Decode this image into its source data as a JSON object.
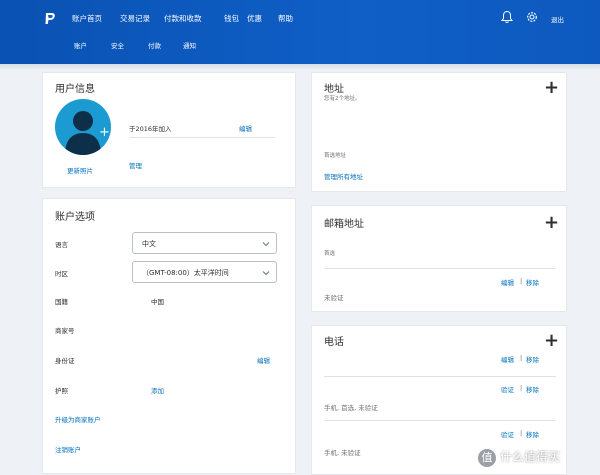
{
  "nav": {
    "items": [
      "账户首页",
      "交易记录",
      "付款和收款",
      "钱包",
      "优惠",
      "帮助"
    ],
    "logout": "退出",
    "subnav": [
      "账户",
      "安全",
      "付款",
      "通知"
    ]
  },
  "profile": {
    "title": "用户信息",
    "joined": "于2016年加入",
    "edit": "编辑",
    "update_photo": "更新照片",
    "manage": "管理"
  },
  "account": {
    "title": "账户选项",
    "language_label": "语言",
    "language_value": "中文",
    "timezone_label": "时区",
    "timezone_value": "（GMT-08:00）太平洋时间",
    "country_label": "国籍",
    "country_value": "中国",
    "merchant_label": "商家号",
    "id_label": "身份证",
    "id_edit": "编辑",
    "passport_label": "护照",
    "passport_add": "添加",
    "upgrade": "升级为商家账户",
    "close": "注销账户"
  },
  "address": {
    "title": "地址",
    "count": "您有2个地址。",
    "preferred": "首选地址",
    "manage_all": "管理所有地址"
  },
  "email": {
    "title": "邮箱地址",
    "preferred": "首选",
    "edit": "编辑",
    "sep": "|",
    "remove": "移除",
    "unverified": "未验证"
  },
  "phone": {
    "title": "电话",
    "edit": "编辑",
    "sep": "|",
    "remove": "移除",
    "verify": "验证",
    "row1": "手机, 首选, 未验证",
    "row2": "手机, 未验证"
  },
  "watermark": "什么值得买",
  "watermark_icon": "值",
  "colors": {
    "header": "#0d5bc2",
    "link": "#0070ba",
    "avatar": "#1b9bd1"
  }
}
